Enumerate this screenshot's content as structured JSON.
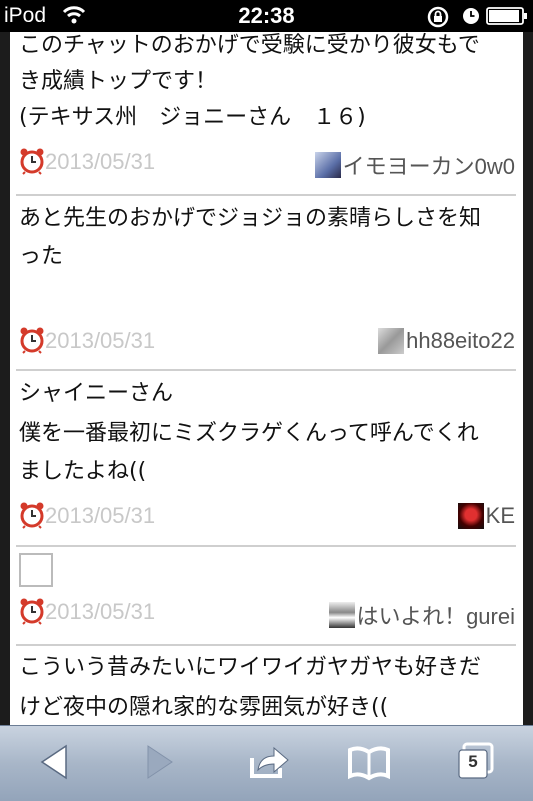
{
  "status_bar": {
    "carrier": "iPod",
    "time": "22:38"
  },
  "posts": [
    {
      "message_lines": [
        "このチャットのおかげで受験に受かり彼女もで",
        "き成績トップです！",
        "(テキサス州　ジョニーさん　１６)"
      ],
      "date": "2013/05/31",
      "user": "イモヨーカン0w0"
    },
    {
      "message_lines": [
        "あと先生のおかげでジョジョの素晴らしさを知",
        "った"
      ],
      "date": "2013/05/31",
      "user": "hh88eito22"
    },
    {
      "message_lines": [
        "シャイニーさん",
        "僕を一番最初にミズクラゲくんって呼んでくれ",
        "ましたよね(("
      ],
      "date": "2013/05/31",
      "user": "KE"
    },
    {
      "message_lines": [],
      "has_image_placeholder": true,
      "date": "2013/05/31",
      "user": "はいよれ！gurei"
    },
    {
      "message_lines": [
        "こういう昔みたいにワイワイガヤガヤも好きだ",
        "けど夜中の隠れ家的な雰囲気が好き(("
      ],
      "date": "",
      "user": ""
    }
  ],
  "toolbar": {
    "tabs_count": "5",
    "icons": [
      "back-arrow-icon",
      "forward-arrow-icon",
      "share-icon",
      "bookmarks-icon",
      "tabs-icon"
    ]
  },
  "colors": {
    "toolbar_top": "#c9d3e0",
    "toolbar_bottom": "#93a4ba",
    "date_text": "#c8c8c8",
    "clock_red": "#d43a2a"
  }
}
